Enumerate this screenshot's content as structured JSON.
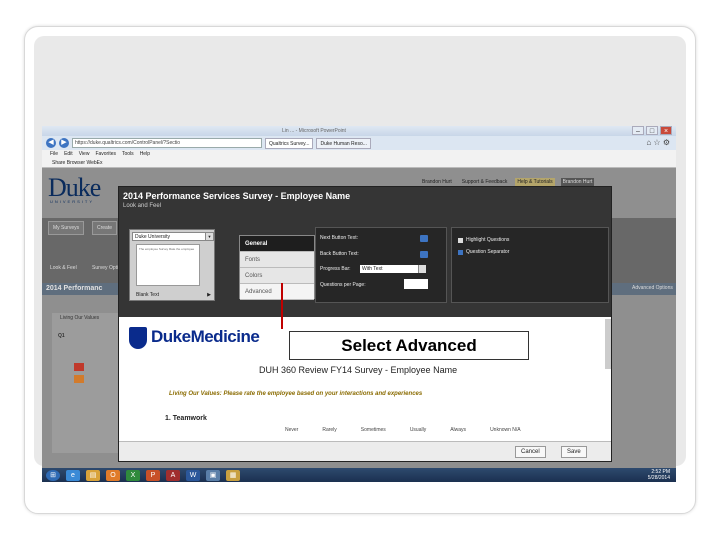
{
  "browser": {
    "title": "Lin ... - Microsoft PowerPoint",
    "window_buttons": [
      "–",
      "□",
      "×"
    ],
    "address": "https://duke.qualtrics.com/ControlPanel/?Sectio",
    "tabs": [
      "Qualtrics Survey...",
      "Duke Human Reso..."
    ],
    "menu": [
      "File",
      "Edit",
      "View",
      "Favorites",
      "Tools",
      "Help"
    ],
    "favorites": "Share Browser  WebEx"
  },
  "duke_page": {
    "logo": "Duke",
    "logo_sub": "UNIVERSITY",
    "util_links": [
      "Brandon Hurt",
      "Support & Feedback",
      "Help & Tutorials",
      "Brandon Hurt"
    ],
    "tabs": [
      "My Surveys",
      "Create"
    ],
    "toolbar_labels": [
      "Look & Feel",
      "Survey Options"
    ],
    "project_title": "2014 Performanc",
    "advanced_options": "Advanced Options",
    "left_panel": [
      "Living Our Values",
      "Q1"
    ]
  },
  "modal": {
    "title": "2014 Performance Services Survey - Employee Name",
    "subtitle": "Look and Feel",
    "theme_name": "Duke University",
    "theme_thumb": "The employee\nSurvey\nRate the employee",
    "theme_footer": "Blank Text",
    "categories": [
      "General",
      "Fonts",
      "Colors",
      "Advanced"
    ],
    "settings": {
      "next_button": "Next Button Text:",
      "back_button": "Back Button Text:",
      "progress_bar": "Progress Bar:",
      "progress_value": "With Text",
      "questions_per_page": "Questions per Page:"
    },
    "options": [
      "Highlight Questions",
      "Question Separator"
    ]
  },
  "preview": {
    "logo_text": "DukeMedicine",
    "callout": "Select Advanced",
    "title": "DUH 360 Review FY14 Survey - Employee Name",
    "subtitle": "Living Our Values: Please rate the employee based on your interactions and experiences",
    "section": "1. Teamwork",
    "columns": [
      "Never",
      "Rarely",
      "Sometimes",
      "Usually",
      "Always",
      "Unknown N/A"
    ]
  },
  "footer": {
    "cancel": "Cancel",
    "save": "Save"
  },
  "taskbar": {
    "time": "2:52 PM",
    "date": "5/28/2014"
  }
}
